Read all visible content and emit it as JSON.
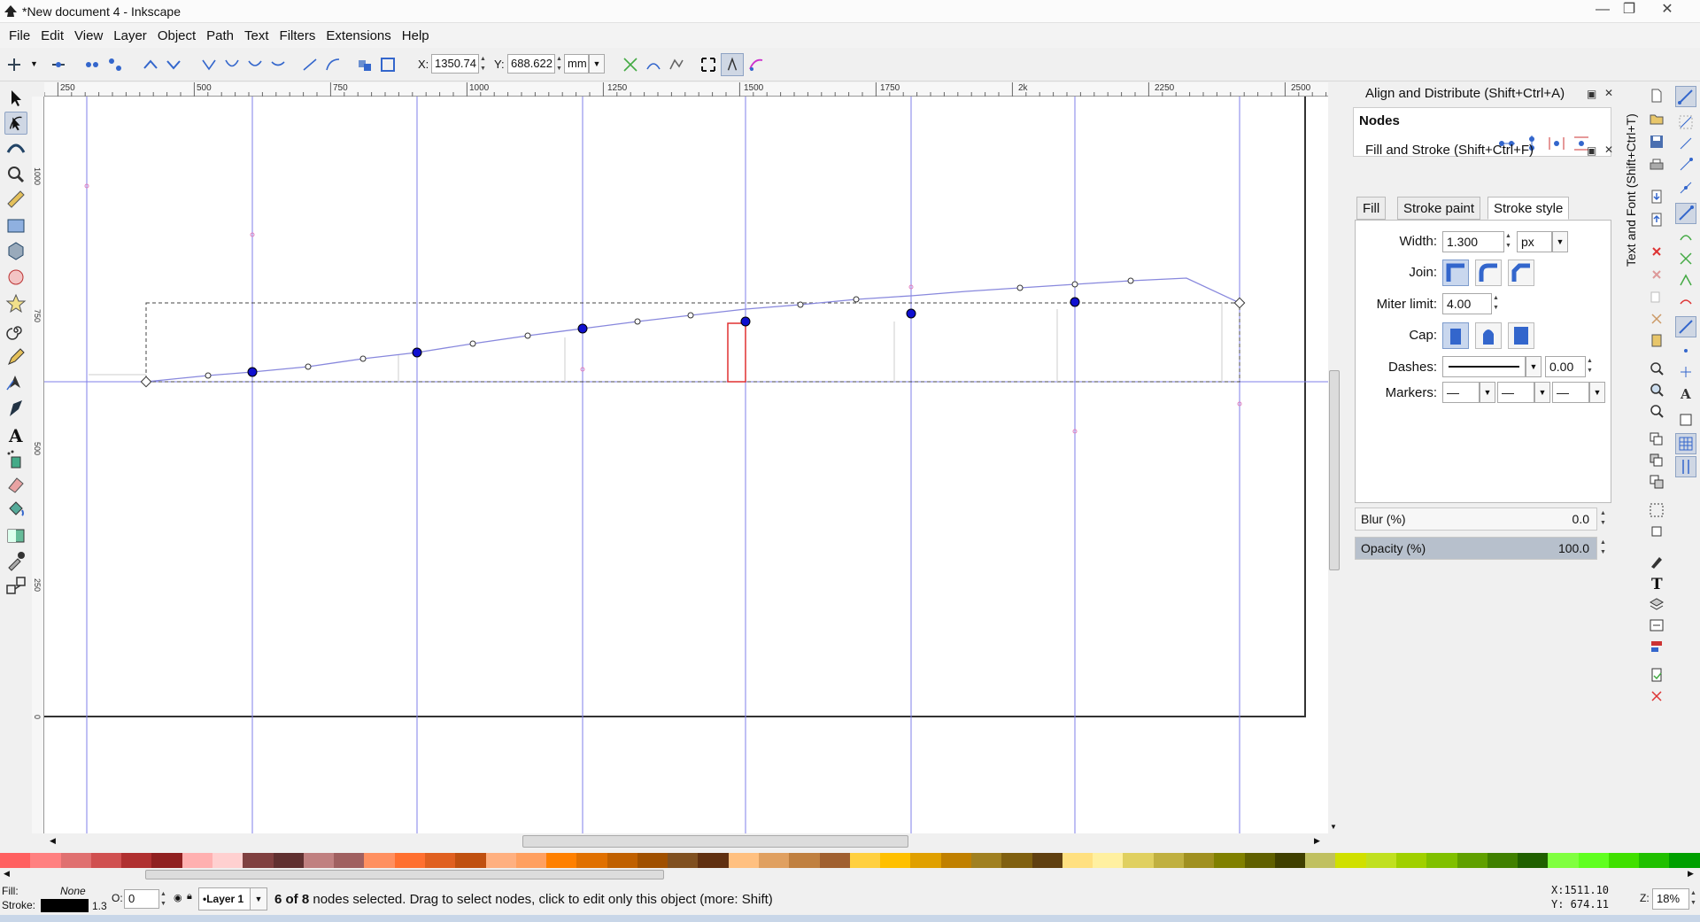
{
  "window": {
    "title": "*New document 4 - Inkscape"
  },
  "menu": [
    "File",
    "Edit",
    "View",
    "Layer",
    "Object",
    "Path",
    "Text",
    "Filters",
    "Extensions",
    "Help"
  ],
  "controls": {
    "x_label": "X:",
    "x_value": "1350.74",
    "y_label": "Y:",
    "y_value": "688.622",
    "unit": "mm"
  },
  "ruler": {
    "h_ticks": [
      "250",
      "500",
      "750",
      "1000",
      "1250",
      "1500",
      "1750",
      "2k",
      "2250",
      "2500"
    ],
    "v_ticks": [
      "1000",
      "750",
      "500",
      "250",
      "0"
    ]
  },
  "dock": {
    "align_title": "Align and Distribute (Shift+Ctrl+A)",
    "nodes_heading": "Nodes",
    "fill_stroke_title": "Fill and Stroke (Shift+Ctrl+F)",
    "tabs": [
      "Fill",
      "Stroke paint",
      "Stroke style"
    ],
    "active_tab": "Stroke style",
    "width_label": "Width:",
    "width_value": "1.300",
    "width_unit": "px",
    "join_label": "Join:",
    "miter_label": "Miter limit:",
    "miter_value": "4.00",
    "cap_label": "Cap:",
    "dashes_label": "Dashes:",
    "dashes_value": "0.00",
    "markers_label": "Markers:",
    "blur_label": "Blur (%)",
    "blur_value": "0.0",
    "opacity_label": "Opacity (%)",
    "opacity_value": "100.0"
  },
  "side_tab": "Text and Font (Shift+Ctrl+T)",
  "status": {
    "fill_label": "Fill:",
    "fill_value": "None",
    "stroke_label": "Stroke:",
    "stroke_width": "1.3",
    "opacity_label": "O:",
    "opacity_value": "0",
    "layer": "•Layer 1",
    "message_bold": "6 of 8",
    "message_rest": " nodes selected. Drag to select nodes, click to edit only this object (more: Shift)",
    "cursor_x": "X:1511.10",
    "cursor_y": "Y:  674.11",
    "zoom_label": "Z:",
    "zoom_value": "18%"
  },
  "colors": {
    "guide": "#7f7fe8",
    "node_selected": "#1010d0",
    "path": "#8888dd",
    "marker": "#e03030",
    "accent": "#4a6fb0"
  }
}
